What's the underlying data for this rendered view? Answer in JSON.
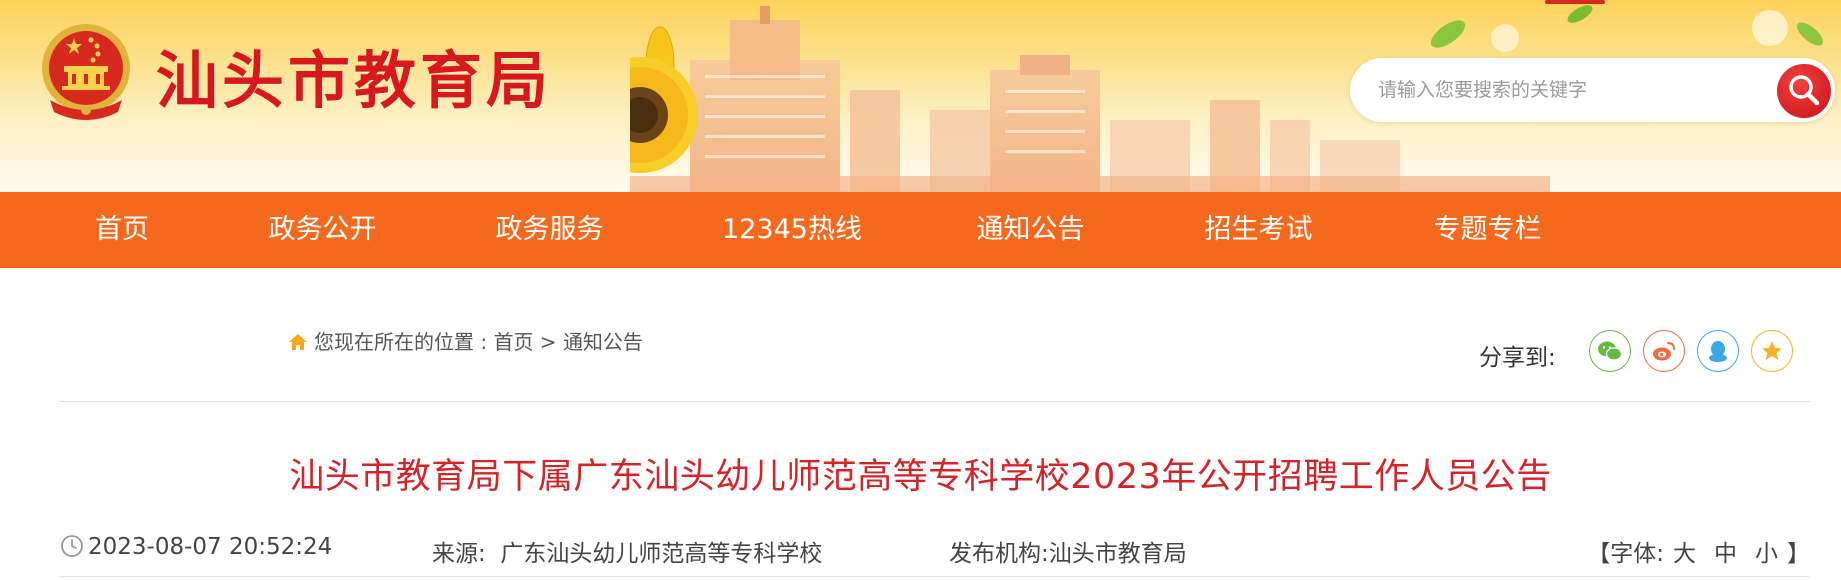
{
  "header": {
    "site_title": "汕头市教育局",
    "emblem_icon": "national-emblem-icon",
    "search": {
      "placeholder": "请输入您要搜索的关键字",
      "icon": "search-icon"
    }
  },
  "nav": {
    "items": [
      {
        "label": "首页"
      },
      {
        "label": "政务公开"
      },
      {
        "label": "政务服务"
      },
      {
        "label": "12345热线"
      },
      {
        "label": "通知公告"
      },
      {
        "label": "招生考试"
      },
      {
        "label": "专题专栏"
      }
    ]
  },
  "breadcrumb": {
    "prefix": "您现在所在的位置 : ",
    "home": "首页",
    "separator": " > ",
    "current": "通知公告",
    "icon": "home-icon"
  },
  "share": {
    "label": "分享到:",
    "items": [
      {
        "icon": "wechat-icon",
        "color": "#67b845"
      },
      {
        "icon": "weibo-icon",
        "color": "#f26a3d"
      },
      {
        "icon": "qq-icon",
        "color": "#3aa6e6"
      },
      {
        "icon": "qzone-star-icon",
        "color": "#f5b02c"
      }
    ]
  },
  "article": {
    "title": "汕头市教育局下属广东汕头幼儿师范高等专科学校2023年公开招聘工作人员公告",
    "datetime": "2023-08-07 20:52:24",
    "source_label": "来源:",
    "source": "广东汕头幼儿师范高等专科学校",
    "publisher_label": "发布机构:",
    "publisher": "汕头市教育局",
    "font_label": "【字体:",
    "font_large": "大",
    "font_medium": "中",
    "font_small": "小",
    "font_close": "】"
  },
  "colors": {
    "brand_red": "#d7191b",
    "nav_orange": "#f5691e",
    "title_red": "#d3242a"
  }
}
